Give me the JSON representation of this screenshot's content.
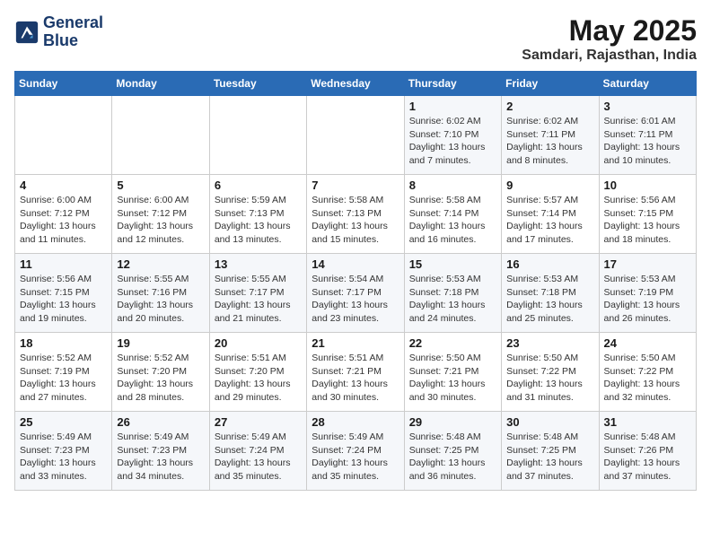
{
  "header": {
    "logo_line1": "General",
    "logo_line2": "Blue",
    "month_year": "May 2025",
    "location": "Samdari, Rajasthan, India"
  },
  "weekdays": [
    "Sunday",
    "Monday",
    "Tuesday",
    "Wednesday",
    "Thursday",
    "Friday",
    "Saturday"
  ],
  "weeks": [
    [
      {
        "day": "",
        "info": ""
      },
      {
        "day": "",
        "info": ""
      },
      {
        "day": "",
        "info": ""
      },
      {
        "day": "",
        "info": ""
      },
      {
        "day": "1",
        "info": "Sunrise: 6:02 AM\nSunset: 7:10 PM\nDaylight: 13 hours\nand 7 minutes."
      },
      {
        "day": "2",
        "info": "Sunrise: 6:02 AM\nSunset: 7:11 PM\nDaylight: 13 hours\nand 8 minutes."
      },
      {
        "day": "3",
        "info": "Sunrise: 6:01 AM\nSunset: 7:11 PM\nDaylight: 13 hours\nand 10 minutes."
      }
    ],
    [
      {
        "day": "4",
        "info": "Sunrise: 6:00 AM\nSunset: 7:12 PM\nDaylight: 13 hours\nand 11 minutes."
      },
      {
        "day": "5",
        "info": "Sunrise: 6:00 AM\nSunset: 7:12 PM\nDaylight: 13 hours\nand 12 minutes."
      },
      {
        "day": "6",
        "info": "Sunrise: 5:59 AM\nSunset: 7:13 PM\nDaylight: 13 hours\nand 13 minutes."
      },
      {
        "day": "7",
        "info": "Sunrise: 5:58 AM\nSunset: 7:13 PM\nDaylight: 13 hours\nand 15 minutes."
      },
      {
        "day": "8",
        "info": "Sunrise: 5:58 AM\nSunset: 7:14 PM\nDaylight: 13 hours\nand 16 minutes."
      },
      {
        "day": "9",
        "info": "Sunrise: 5:57 AM\nSunset: 7:14 PM\nDaylight: 13 hours\nand 17 minutes."
      },
      {
        "day": "10",
        "info": "Sunrise: 5:56 AM\nSunset: 7:15 PM\nDaylight: 13 hours\nand 18 minutes."
      }
    ],
    [
      {
        "day": "11",
        "info": "Sunrise: 5:56 AM\nSunset: 7:15 PM\nDaylight: 13 hours\nand 19 minutes."
      },
      {
        "day": "12",
        "info": "Sunrise: 5:55 AM\nSunset: 7:16 PM\nDaylight: 13 hours\nand 20 minutes."
      },
      {
        "day": "13",
        "info": "Sunrise: 5:55 AM\nSunset: 7:17 PM\nDaylight: 13 hours\nand 21 minutes."
      },
      {
        "day": "14",
        "info": "Sunrise: 5:54 AM\nSunset: 7:17 PM\nDaylight: 13 hours\nand 23 minutes."
      },
      {
        "day": "15",
        "info": "Sunrise: 5:53 AM\nSunset: 7:18 PM\nDaylight: 13 hours\nand 24 minutes."
      },
      {
        "day": "16",
        "info": "Sunrise: 5:53 AM\nSunset: 7:18 PM\nDaylight: 13 hours\nand 25 minutes."
      },
      {
        "day": "17",
        "info": "Sunrise: 5:53 AM\nSunset: 7:19 PM\nDaylight: 13 hours\nand 26 minutes."
      }
    ],
    [
      {
        "day": "18",
        "info": "Sunrise: 5:52 AM\nSunset: 7:19 PM\nDaylight: 13 hours\nand 27 minutes."
      },
      {
        "day": "19",
        "info": "Sunrise: 5:52 AM\nSunset: 7:20 PM\nDaylight: 13 hours\nand 28 minutes."
      },
      {
        "day": "20",
        "info": "Sunrise: 5:51 AM\nSunset: 7:20 PM\nDaylight: 13 hours\nand 29 minutes."
      },
      {
        "day": "21",
        "info": "Sunrise: 5:51 AM\nSunset: 7:21 PM\nDaylight: 13 hours\nand 30 minutes."
      },
      {
        "day": "22",
        "info": "Sunrise: 5:50 AM\nSunset: 7:21 PM\nDaylight: 13 hours\nand 30 minutes."
      },
      {
        "day": "23",
        "info": "Sunrise: 5:50 AM\nSunset: 7:22 PM\nDaylight: 13 hours\nand 31 minutes."
      },
      {
        "day": "24",
        "info": "Sunrise: 5:50 AM\nSunset: 7:22 PM\nDaylight: 13 hours\nand 32 minutes."
      }
    ],
    [
      {
        "day": "25",
        "info": "Sunrise: 5:49 AM\nSunset: 7:23 PM\nDaylight: 13 hours\nand 33 minutes."
      },
      {
        "day": "26",
        "info": "Sunrise: 5:49 AM\nSunset: 7:23 PM\nDaylight: 13 hours\nand 34 minutes."
      },
      {
        "day": "27",
        "info": "Sunrise: 5:49 AM\nSunset: 7:24 PM\nDaylight: 13 hours\nand 35 minutes."
      },
      {
        "day": "28",
        "info": "Sunrise: 5:49 AM\nSunset: 7:24 PM\nDaylight: 13 hours\nand 35 minutes."
      },
      {
        "day": "29",
        "info": "Sunrise: 5:48 AM\nSunset: 7:25 PM\nDaylight: 13 hours\nand 36 minutes."
      },
      {
        "day": "30",
        "info": "Sunrise: 5:48 AM\nSunset: 7:25 PM\nDaylight: 13 hours\nand 37 minutes."
      },
      {
        "day": "31",
        "info": "Sunrise: 5:48 AM\nSunset: 7:26 PM\nDaylight: 13 hours\nand 37 minutes."
      }
    ]
  ]
}
